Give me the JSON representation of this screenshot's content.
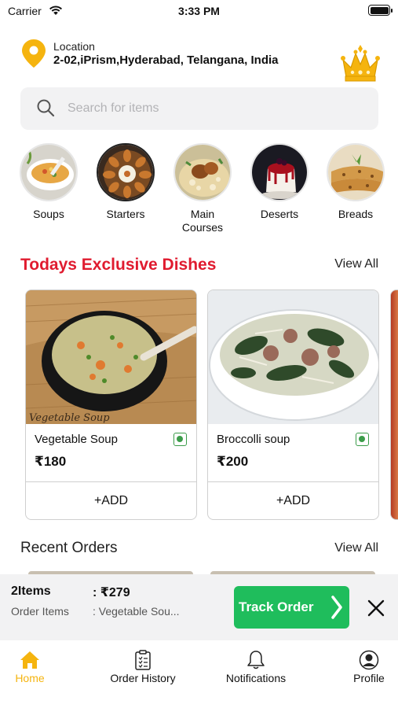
{
  "status_bar": {
    "carrier": "Carrier",
    "time": "3:33 PM"
  },
  "location": {
    "label": "Location",
    "address": "2-02,iPrism,Hyderabad, Telangana, India",
    "pin_color": "#f5b40f"
  },
  "search": {
    "placeholder": "Search for items"
  },
  "categories": [
    {
      "label": "Soups",
      "icon": "soup-photo"
    },
    {
      "label": "Starters",
      "icon": "starters-photo"
    },
    {
      "label": "Main\nCourses",
      "icon": "main-courses-photo"
    },
    {
      "label": "Deserts",
      "icon": "deserts-photo"
    },
    {
      "label": "Breads",
      "icon": "breads-photo"
    }
  ],
  "exclusive": {
    "title": "Todays Exclusive Dishes",
    "view_all": "View All",
    "title_color": "#e01b2f",
    "dishes": [
      {
        "name": "Vegetable Soup",
        "price": "₹180",
        "add_label": "+ADD",
        "image_caption": "Vegetable Soup",
        "veg": true
      },
      {
        "name": "Broccolli soup",
        "price": "₹200",
        "add_label": "+ADD",
        "veg": true
      }
    ]
  },
  "recent_orders": {
    "title": "Recent Orders",
    "view_all": "View All"
  },
  "cart": {
    "count": "2Items",
    "total": ": ₹279",
    "items_label": "Order Items",
    "items_value": ": Vegetable Sou...",
    "track_label": "Track Order",
    "track_color": "#1fbd5c"
  },
  "tab_bar": {
    "active_color": "#f5b40f",
    "tabs": [
      {
        "label": "Home",
        "icon": "home-icon",
        "active": true
      },
      {
        "label": "Order History",
        "icon": "clipboard-icon",
        "active": false
      },
      {
        "label": "Notifications",
        "icon": "bell-icon",
        "active": false
      },
      {
        "label": "Profile",
        "icon": "user-circle-icon",
        "active": false
      }
    ]
  }
}
